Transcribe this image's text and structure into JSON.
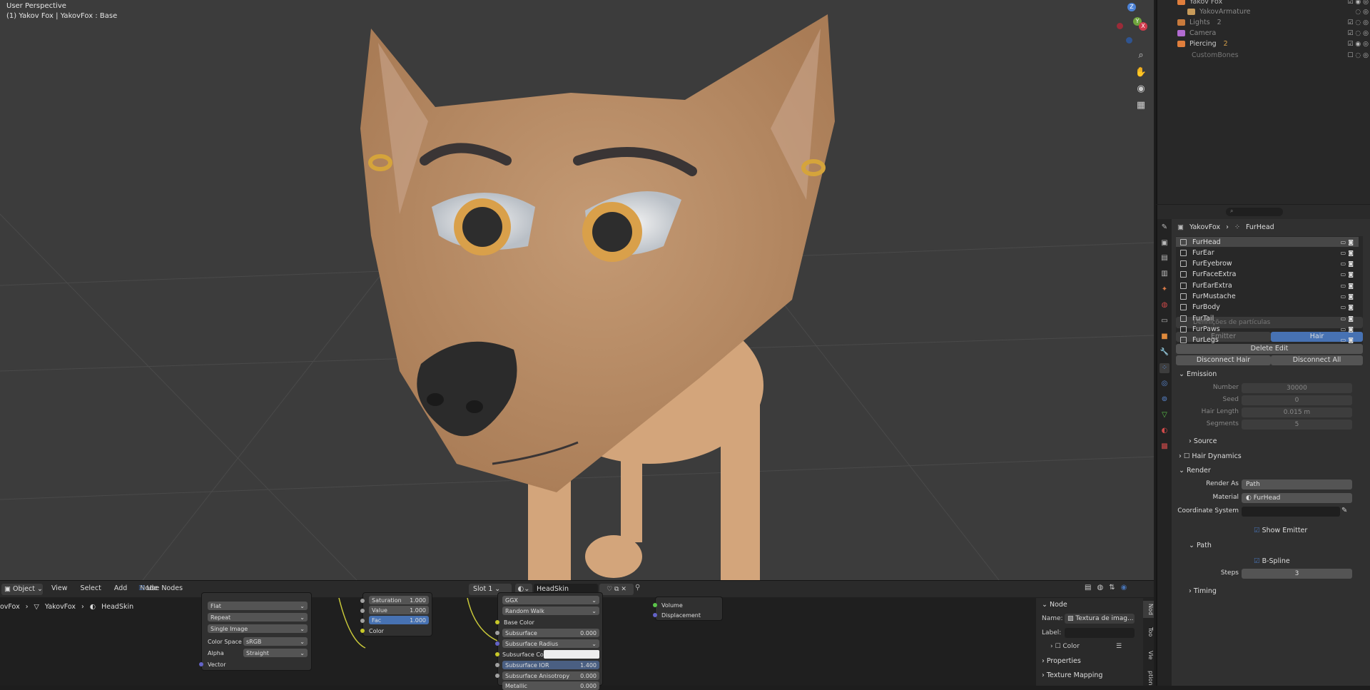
{
  "viewport": {
    "title": "User Perspective",
    "subtitle": "(1) Yakov Fox | YakovFox : Base",
    "gizmo": {
      "x": "X",
      "y": "Y",
      "z": "Z"
    }
  },
  "outliner": {
    "items": [
      {
        "label": "Yakov Fox",
        "color": "#e07e3c"
      },
      {
        "label": "YakovArmature",
        "color": "#c89b5a"
      },
      {
        "label": "Lights",
        "color": "#c87a3c",
        "badge": "2"
      },
      {
        "label": "Camera",
        "color": "#b26bd1"
      },
      {
        "label": "Piercing",
        "color": "#e07e3c",
        "badge": "2"
      },
      {
        "label": "CustomBones",
        "color": "#888888"
      }
    ]
  },
  "properties": {
    "breadcrumb": {
      "object": "YakovFox",
      "system": "FurHead"
    },
    "particle_systems": [
      "FurHead",
      "FurEar",
      "FurEyebrow",
      "FurFaceExtra",
      "FurEarExtra",
      "FurMustache",
      "FurBody",
      "FurTail",
      "FurPaws",
      "FurLegs"
    ],
    "settings_placeholder": "Definições de partículas",
    "type_tabs": {
      "emitter": "Emitter",
      "hair": "Hair"
    },
    "delete_edit": "Delete Edit",
    "disconnect_hair": "Disconnect Hair",
    "disconnect_all": "Disconnect All",
    "emission": {
      "header": "Emission",
      "number_label": "Number",
      "number": "30000",
      "seed_label": "Seed",
      "seed": "0",
      "hair_length_label": "Hair Length",
      "hair_length": "0.015 m",
      "segments_label": "Segments",
      "segments": "5"
    },
    "source": "Source",
    "hair_dynamics": "Hair Dynamics",
    "render": {
      "header": "Render",
      "render_as_label": "Render As",
      "render_as": "Path",
      "material_label": "Material",
      "material": "FurHead",
      "coord_label": "Coordinate System",
      "show_emitter": "Show Emitter"
    },
    "path": {
      "header": "Path",
      "bspline": "B-Spline",
      "steps_label": "Steps",
      "steps": "3"
    },
    "timing": "Timing"
  },
  "node_editor": {
    "header": {
      "mode": "Object",
      "menus": [
        "View",
        "Select",
        "Add",
        "Node"
      ],
      "use_nodes": "Use Nodes",
      "slot": "Slot 1",
      "material": "HeadSkin"
    },
    "breadcrumb": {
      "a": "ovFox",
      "b": "YakovFox",
      "c": "HeadSkin"
    },
    "image_node": {
      "interp": "Flat",
      "ext": "Repeat",
      "src": "Single Image",
      "colorspace_label": "Color Space",
      "colorspace": "sRGB",
      "alpha_label": "Alpha",
      "alpha": "Straight",
      "vector": "Vector"
    },
    "hsv_node": {
      "sat_label": "Saturation",
      "sat": "1.000",
      "val_label": "Value",
      "val": "1.000",
      "fac_label": "Fac",
      "fac": "1.000",
      "color": "Color"
    },
    "bsdf_node": {
      "dist": "GGX",
      "sss_method": "Random Walk",
      "base_color": "Base Color",
      "subsurface_label": "Subsurface",
      "subsurface": "0.000",
      "sss_radius": "Subsurface Radius",
      "sss_color": "Subsurface Color",
      "sss_ior_label": "Subsurface IOR",
      "sss_ior": "1.400",
      "sss_aniso_label": "Subsurface Anisotropy",
      "sss_aniso": "0.000",
      "metallic_label": "Metallic",
      "metallic": "0.000"
    },
    "output_node": {
      "volume": "Volume",
      "displacement": "Displacement"
    },
    "side_panel": {
      "header": "Node",
      "name_label": "Name:",
      "name": "Textura de imag...",
      "label_label": "Label:",
      "color": "Color",
      "properties": "Properties",
      "texture_mapping": "Texture Mapping"
    },
    "side_tabs": [
      "Nod",
      "Too",
      "Vie",
      "ption"
    ]
  }
}
